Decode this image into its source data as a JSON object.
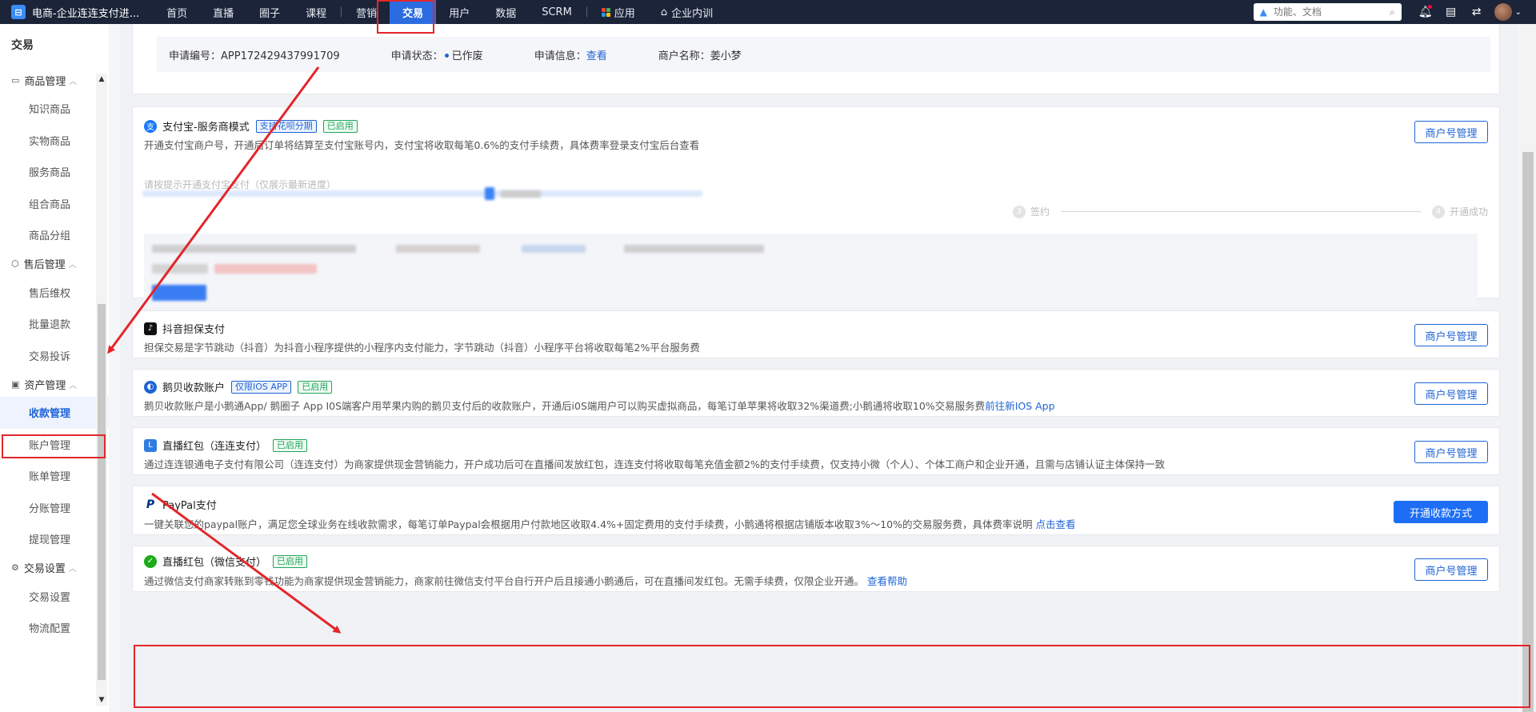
{
  "app": {
    "title": "电商-企业连连支付进...",
    "logo_icon": "app-logo-icon"
  },
  "nav": {
    "items": [
      "首页",
      "直播",
      "圈子",
      "课程",
      "营销",
      "交易",
      "用户",
      "数据",
      "SCRM",
      "应用",
      "企业内训"
    ],
    "active": "交易"
  },
  "search": {
    "placeholder": "功能、文档"
  },
  "sidebar": {
    "title": "交易",
    "groups": [
      {
        "label": "商品管理",
        "items": [
          "知识商品",
          "实物商品",
          "服务商品",
          "组合商品",
          "商品分组"
        ]
      },
      {
        "label": "售后管理",
        "items": [
          "售后维权",
          "批量退款",
          "交易投诉"
        ]
      },
      {
        "label": "资产管理",
        "items": [
          "收款管理",
          "账户管理",
          "账单管理",
          "分账管理",
          "提现管理"
        ]
      },
      {
        "label": "交易设置",
        "items": [
          "交易设置",
          "物流配置"
        ]
      }
    ],
    "active_item": "收款管理"
  },
  "application": {
    "number_label": "申请编号：",
    "number": "APP172429437991709",
    "status_label": "申请状态：",
    "status": "已作废",
    "info_label": "申请信息：",
    "info_link": "查看",
    "merchant_label": "商户名称：",
    "merchant": "姜小梦"
  },
  "cards": {
    "alipay": {
      "title": "支付宝-服务商模式",
      "tag_blue": "支持花呗分期",
      "tag_green": "已启用",
      "desc": "开通支付宝商户号，开通后订单将结算至支付宝账号内，支付宝将收取每笔0.6%的支付手续费，具体费率登录支付宝后台查看",
      "button": "商户号管理",
      "hint": "请按提示开通支付宝支付（仅展示最新进度）",
      "step3_num": "3",
      "step3": "签约",
      "step4_num": "4",
      "step4": "开通成功"
    },
    "douyin": {
      "title": "抖音担保支付",
      "desc": "担保交易是字节跳动（抖音）为抖音小程序提供的小程序内支付能力，字节跳动（抖音）小程序平台将收取每笔2%平台服务费",
      "button": "商户号管理"
    },
    "ebei": {
      "title": "鹅贝收款账户",
      "tag_blue": "仅限IOS APP",
      "tag_green": "已启用",
      "desc": "鹅贝收款账户是小鹅通App/ 鹅圈子 App I0S端客户用苹果内购的鹅贝支付后的收款账户，开通后i0S端用户可以购买虚拟商品，每笔订单苹果将收取32%渠道费;小鹅通将收取10%交易服务费",
      "link": "前往新IOS App",
      "button": "商户号管理"
    },
    "lianlian": {
      "title": "直播红包（连连支付）",
      "tag_green": "已启用",
      "desc": "通过连连银通电子支付有限公司（连连支付）为商家提供现金营销能力，开户成功后可在直播间发放红包，连连支付将收取每笔充值金额2%的支付手续费，仅支持小微（个人）、个体工商户和企业开通，且需与店铺认证主体保持一致",
      "button": "商户号管理"
    },
    "paypal": {
      "title": "PayPal支付",
      "desc": "一键关联您的paypal账户，满足您全球业务在线收款需求，每笔订单Paypal会根据用户付款地区收取4.4%+固定费用的支付手续费，小鹅通将根据店铺版本收取3%～10%的交易服务费，具体费率说明",
      "link": "点击查看",
      "button": "开通收款方式"
    },
    "wechat": {
      "title": "直播红包（微信支付）",
      "tag_green": "已启用",
      "desc": "通过微信支付商家转账到零钱功能为商家提供现金营销能力，商家前往微信支付平台自行开户后且接通小鹅通后，可在直播间发红包。无需手续费，仅限企业开通。",
      "link": "查看帮助",
      "button": "商户号管理"
    }
  },
  "colors": {
    "accent": "#1e63d6",
    "annotation": "#e3262b",
    "success": "#25a55b",
    "topbar": "#1b2438"
  }
}
